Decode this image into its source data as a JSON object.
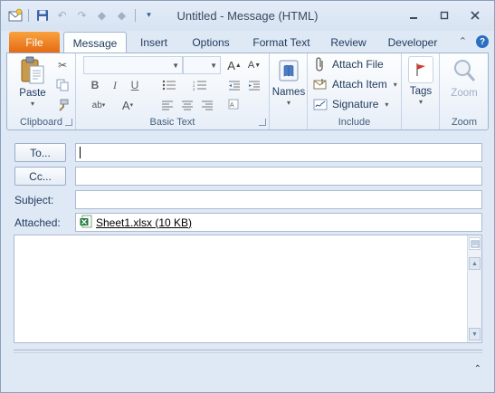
{
  "window": {
    "title": "Untitled  -  Message (HTML)"
  },
  "qat": {
    "items": [
      "envelope-app-icon",
      "save-icon",
      "undo-icon",
      "redo-icon",
      "up-icon",
      "down-icon",
      "customize-icon"
    ]
  },
  "tabs": {
    "file": "File",
    "message": "Message",
    "insert": "Insert",
    "options": "Options",
    "format_text": "Format Text",
    "review": "Review",
    "developer": "Developer"
  },
  "ribbon": {
    "clipboard": {
      "label": "Clipboard",
      "paste": "Paste"
    },
    "basic_text": {
      "label": "Basic Text",
      "bold": "B",
      "italic": "I",
      "underline": "U",
      "font_color": "A"
    },
    "names": {
      "label": "Names"
    },
    "include": {
      "label": "Include",
      "attach_file": "Attach File",
      "attach_item": "Attach Item",
      "signature": "Signature"
    },
    "tags": {
      "label": "Tags"
    },
    "zoom": {
      "label": "Zoom",
      "zoom_btn": "Zoom"
    }
  },
  "header": {
    "to_button": "To...",
    "cc_button": "Cc...",
    "subject_label": "Subject:",
    "attached_label": "Attached:",
    "to_value": "",
    "cc_value": "",
    "subject_value": "",
    "attachment_name": "Sheet1.xlsx (10 KB)"
  },
  "colors": {
    "file_tab": "#e46a14",
    "window_bg": "#dfe9f5",
    "accent_blue": "#2b579a"
  }
}
